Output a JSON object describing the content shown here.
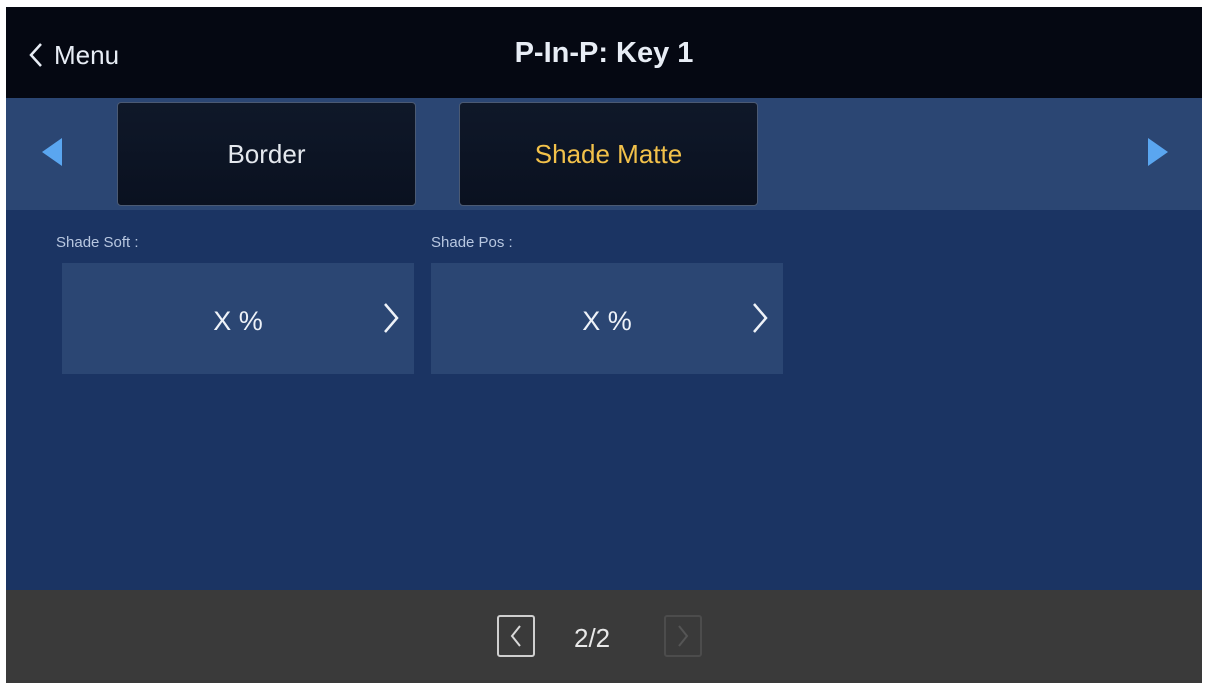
{
  "header": {
    "back_label": "Menu",
    "title": "P-In-P: Key 1"
  },
  "tabs": [
    {
      "label": "Border",
      "selected": false
    },
    {
      "label": "Shade Matte",
      "selected": true
    }
  ],
  "params": [
    {
      "label": "Shade Soft :",
      "value": "X %"
    },
    {
      "label": "Shade Pos :",
      "value": "X %"
    }
  ],
  "footer": {
    "page_indicator": "2/2"
  },
  "colors": {
    "background": "#1b3463",
    "header": "#050812",
    "tab_bar": "#2b4673",
    "selected_tab_text": "#f2c14a",
    "arrow": "#5aa6f0",
    "footer": "#3a3a3a"
  },
  "icons": {
    "back": "chevron-left-icon",
    "tab_prev": "triangle-left-icon",
    "tab_next": "triangle-right-icon",
    "param_open": "chevron-right-icon",
    "page_prev": "chevron-left-icon",
    "page_next": "chevron-right-icon"
  }
}
